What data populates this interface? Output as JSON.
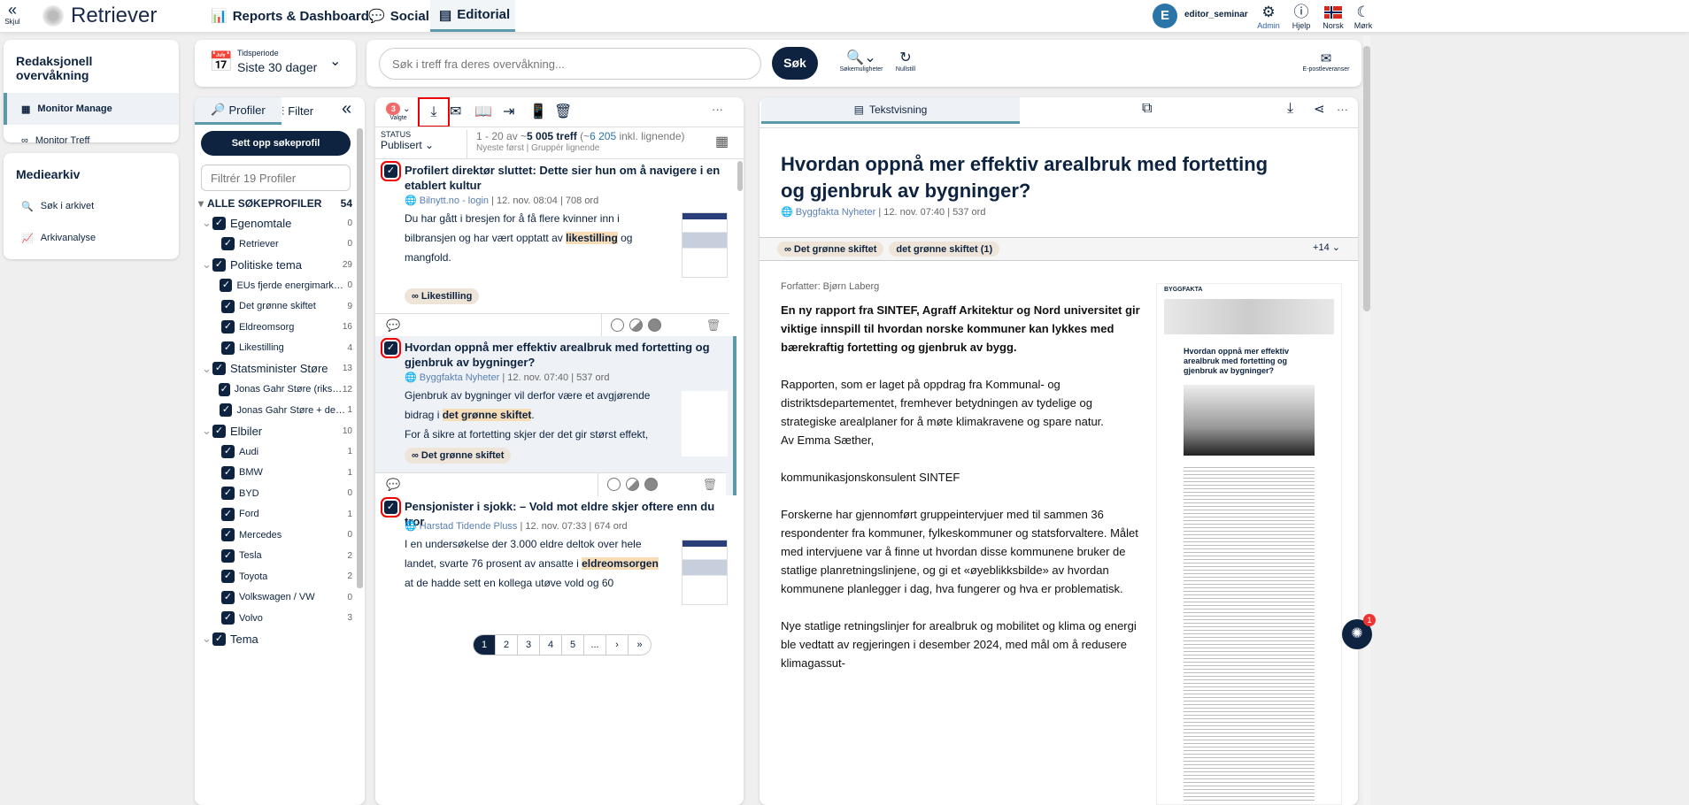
{
  "topbar": {
    "hide_label": "Skjul",
    "logo": "Retriever",
    "nav": [
      "Reports & Dashboards",
      "Social",
      "Editorial"
    ],
    "user_initial": "E",
    "username": "editor_seminar",
    "admin": "Admin",
    "help": "Hjelp",
    "language": "Norsk",
    "dark": "Mørk"
  },
  "sidebar": {
    "section1": "Redaksjonell overvåkning",
    "items1": [
      "Monitor Manage",
      "Monitor Treff"
    ],
    "section2": "Mediearkiv",
    "items2": [
      "Søk i arkivet",
      "Arkivanalyse"
    ]
  },
  "period": {
    "label": "Tidsperiode",
    "value": "Siste 30 dager"
  },
  "search": {
    "placeholder": "Søk i treff fra deres overvåkning...",
    "button": "Søk",
    "options": "Søkemuligheter",
    "reset": "Nullstill",
    "email": "E-postleveranser"
  },
  "profiles": {
    "tab_profiles": "Profiler",
    "tab_filter": "Filter",
    "setup_button": "Sett opp søkeprofil",
    "filter_placeholder": "Filtrér 19 Profiler",
    "all_label": "ALLE SØKEPROFILER",
    "all_count": "54",
    "rows": [
      {
        "label": "Egenomtale",
        "count": "0",
        "group": true
      },
      {
        "label": "Retriever",
        "count": "0"
      },
      {
        "label": "Politiske tema",
        "count": "29",
        "group": true
      },
      {
        "label": "EUs fjerde energimarkedspa...",
        "count": "0"
      },
      {
        "label": "Det grønne skiftet",
        "count": "9"
      },
      {
        "label": "Eldreomsorg",
        "count": "16"
      },
      {
        "label": "Likestilling",
        "count": "4"
      },
      {
        "label": "Statsminister Støre",
        "count": "13",
        "group": true
      },
      {
        "label": "Jonas Gahr Støre (riksdekk...",
        "count": "12"
      },
      {
        "label": "Jonas Gahr Støre + det grøn...",
        "count": "1"
      },
      {
        "label": "Elbiler",
        "count": "10",
        "group": true
      },
      {
        "label": "Audi",
        "count": "1"
      },
      {
        "label": "BMW",
        "count": "1"
      },
      {
        "label": "BYD",
        "count": "0"
      },
      {
        "label": "Ford",
        "count": "1"
      },
      {
        "label": "Mercedes",
        "count": "0"
      },
      {
        "label": "Tesla",
        "count": "2"
      },
      {
        "label": "Toyota",
        "count": "2"
      },
      {
        "label": "Volkswagen / VW",
        "count": "0"
      },
      {
        "label": "Volvo",
        "count": "3"
      },
      {
        "label": "Tema",
        "count": "",
        "group": true
      }
    ]
  },
  "list": {
    "selected_count": "3",
    "selected_label": "Valgte",
    "status_label": "STATUS",
    "status_value": "Publisert",
    "range": "1 - 20 av ~",
    "total": "5 005 treff",
    "similar_pre": " (~",
    "similar_num": "6 205",
    "similar_post": " inkl. lignende)",
    "sort": "Nyeste først",
    "group": "Gruppér lignende",
    "articles": [
      {
        "title": "Profilert direktør sluttet: Dette sier hun om å navigere i en etablert kultur",
        "source": "Bilnytt.no - login",
        "date": "12. nov. 08:04",
        "words": "708 ord",
        "pre": "Du har gått i bresjen for å få flere kvinner inn i bilbransjen og har vært opptatt av ",
        "hl": "likestilling",
        "post": " og mangfold.",
        "tag": "Likestilling"
      },
      {
        "title": "Hvordan oppnå mer effektiv arealbruk med fortetting og gjenbruk av bygninger?",
        "source": "Byggfakta Nyheter",
        "date": "12. nov. 07:40",
        "words": "537 ord",
        "pre": "Gjenbruk av bygninger vil derfor være et avgjørende bidrag i ",
        "hl": "det grønne skiftet",
        "post": ".",
        "line2": "For å sikre at fortetting skjer der det gir størst effekt,",
        "tag": "Det grønne skiftet"
      },
      {
        "title": "Pensjonister i sjokk: – Vold mot eldre skjer oftere enn du tror",
        "source": "Harstad Tidende Pluss",
        "date": "12. nov. 07:33",
        "words": "674 ord",
        "pre": "I en undersøkelse der 3.000 eldre deltok over hele landet, svarte 76 prosent av ansatte i ",
        "hl": "eldreomsorgen",
        "post": " at de hadde sett en kollega utøve vold og 60"
      }
    ],
    "pages": [
      "1",
      "2",
      "3",
      "4",
      "5",
      "..."
    ]
  },
  "reader": {
    "tab": "Tekstvisning",
    "title": "Hvordan oppnå mer effektiv arealbruk med fortetting og gjenbruk av bygninger?",
    "source": "Byggfakta Nyheter",
    "date": "12. nov. 07:40",
    "words": "537 ord",
    "tags": [
      "Det grønne skiftet",
      "det grønne skiftet (1)"
    ],
    "more_tags": "+14",
    "author": "Forfatter: Bjørn Laberg",
    "lead": "En ny rapport fra SINTEF, Agraff Arkitektur og Nord universitet gir viktige innspill til hvordan norske kommuner kan lykkes med bærekraftig fortetting og gjenbruk av bygg.",
    "p1": "Rapporten, som er laget på oppdrag fra Kommunal- og distriktsdepartementet, fremhever betydningen av tydelige og strategiske arealplaner for å møte klimakravene og spare natur.",
    "p1b": "Av Emma Sæther,",
    "p2": "kommunikasjonskonsulent SINTEF",
    "p3": "Forskerne har gjennomført gruppeintervjuer med til sammen 36 respondenter fra kommuner, fylkeskommuner og statsforvaltere. Målet med intervjuene var å finne ut hvordan disse kommunene bruker de statlige planretningslinjene, og gi et «øyeblikksbilde» av hvordan kommunene planlegger i dag, hva fungerer og hva er problematisk.",
    "p4": "Nye statlige retningslinjer for arealbruk og mobilitet og klima og energi ble vedtatt av regjeringen i desember 2024, med mål om å redusere klimagassut-",
    "preview_brand": "BYGGFAKTA",
    "preview_title": "Hvordan oppnå mer effektiv arealbruk med fortetting og gjenbruk av bygninger?",
    "chat_badge": "1"
  },
  "colors": {
    "navy": "#0d2340",
    "accent": "#5b9aa9",
    "highlight": "#f7dcb8",
    "tag": "#efe4d8",
    "badge": "#f06b6b"
  }
}
